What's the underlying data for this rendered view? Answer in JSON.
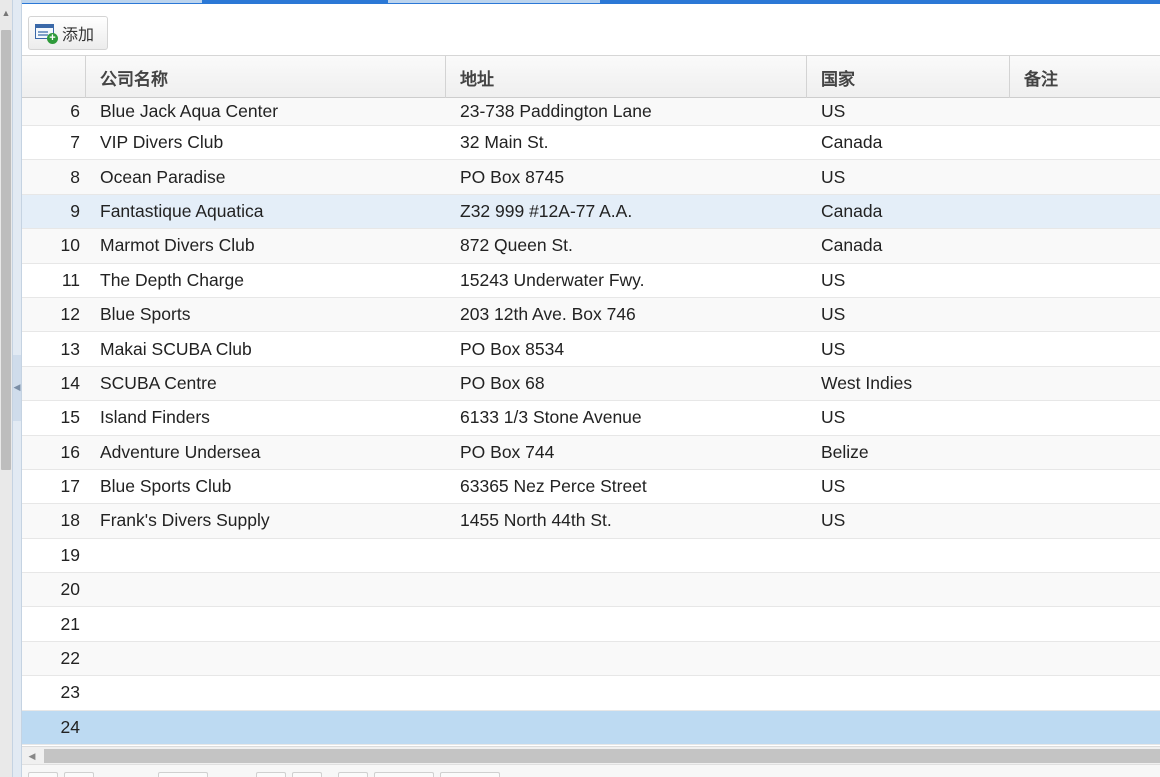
{
  "toolbar": {
    "add_label": "添加"
  },
  "grid": {
    "columns": [
      "",
      "公司名称",
      "地址",
      "国家",
      "备注"
    ],
    "rows": [
      {
        "num": "6",
        "name": "Blue Jack Aqua Center",
        "address": "23-738 Paddington Lane",
        "country": "US",
        "note": ""
      },
      {
        "num": "7",
        "name": "VIP Divers Club",
        "address": "32 Main St.",
        "country": "Canada",
        "note": ""
      },
      {
        "num": "8",
        "name": "Ocean Paradise",
        "address": "PO Box 8745",
        "country": "US",
        "note": ""
      },
      {
        "num": "9",
        "name": "Fantastique Aquatica",
        "address": "Z32 999 #12A-77 A.A.",
        "country": "Canada",
        "note": ""
      },
      {
        "num": "10",
        "name": "Marmot Divers Club",
        "address": "872 Queen St.",
        "country": "Canada",
        "note": ""
      },
      {
        "num": "11",
        "name": "The Depth Charge",
        "address": "15243 Underwater Fwy.",
        "country": "US",
        "note": ""
      },
      {
        "num": "12",
        "name": "Blue Sports",
        "address": "203 12th Ave. Box 746",
        "country": "US",
        "note": ""
      },
      {
        "num": "13",
        "name": "Makai SCUBA Club",
        "address": "PO Box 8534",
        "country": "US",
        "note": ""
      },
      {
        "num": "14",
        "name": "SCUBA Centre",
        "address": "PO Box 68",
        "country": "West Indies",
        "note": ""
      },
      {
        "num": "15",
        "name": "Island Finders",
        "address": "6133 1/3 Stone Avenue",
        "country": "US",
        "note": ""
      },
      {
        "num": "16",
        "name": "Adventure Undersea",
        "address": "PO Box 744",
        "country": "Belize",
        "note": ""
      },
      {
        "num": "17",
        "name": "Blue Sports Club",
        "address": "63365 Nez Perce Street",
        "country": "US",
        "note": ""
      },
      {
        "num": "18",
        "name": "Frank's Divers Supply",
        "address": "1455 North 44th St.",
        "country": "US",
        "note": ""
      },
      {
        "num": "19",
        "name": "",
        "address": "",
        "country": "",
        "note": ""
      },
      {
        "num": "20",
        "name": "",
        "address": "",
        "country": "",
        "note": ""
      },
      {
        "num": "21",
        "name": "",
        "address": "",
        "country": "",
        "note": ""
      },
      {
        "num": "22",
        "name": "",
        "address": "",
        "country": "",
        "note": ""
      },
      {
        "num": "23",
        "name": "",
        "address": "",
        "country": "",
        "note": ""
      },
      {
        "num": "24",
        "name": "",
        "address": "",
        "country": "",
        "note": ""
      }
    ],
    "hover_row": "9",
    "selected_row": "24"
  },
  "colors": {
    "accent": "#2b78d6",
    "row_hover": "#e4eef8",
    "row_selected": "#bddaf2",
    "add_icon_plus": "#2e9a3a"
  },
  "icons": {
    "add": "table-add-icon"
  }
}
